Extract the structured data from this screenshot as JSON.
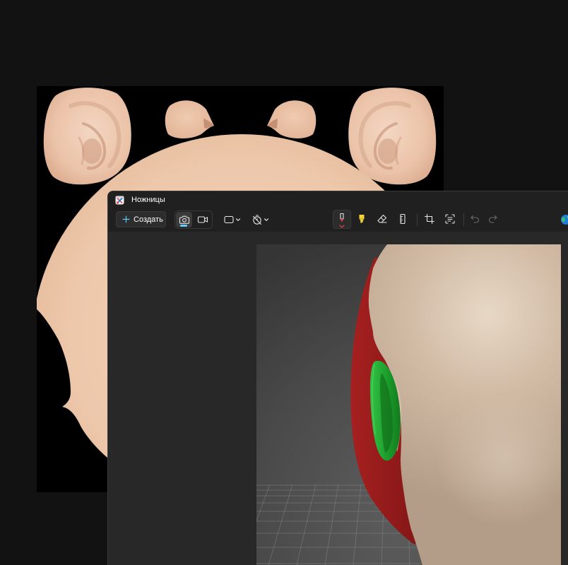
{
  "window": {
    "title": "Ножницы",
    "icon": "snipping-tool-icon"
  },
  "toolbar": {
    "new_snip": {
      "label": "Создать",
      "icon": "plus-icon"
    },
    "mode_switch": [
      {
        "icon": "camera-icon",
        "selected": true
      },
      {
        "icon": "video-icon",
        "selected": false
      }
    ],
    "snip_shape": {
      "icon": "rectangle-snip-icon",
      "menu_icon": "chevron-down-icon"
    },
    "delay": {
      "icon": "timer-off-icon",
      "menu_icon": "chevron-down-icon"
    },
    "markup_tools": [
      {
        "icon": "ballpoint-pen-icon",
        "active": true,
        "color": "#e8414f"
      },
      {
        "icon": "highlighter-icon",
        "active": false,
        "color": "#f5d33b"
      },
      {
        "icon": "eraser-icon",
        "active": false
      },
      {
        "icon": "ruler-icon",
        "active": false
      }
    ],
    "image_tools": [
      {
        "icon": "crop-icon"
      },
      {
        "icon": "text-actions-icon"
      }
    ],
    "history": [
      {
        "icon": "undo-icon",
        "enabled": false
      },
      {
        "icon": "redo-icon",
        "enabled": false
      }
    ],
    "overflow_icon": "paint-icon"
  },
  "colors": {
    "accent": "#60cdff",
    "pen": "#e8414f",
    "highlighter": "#f5d33b",
    "window_bg": "#202020",
    "canvas_bg": "#282828",
    "desktop_bg": "#121212"
  }
}
